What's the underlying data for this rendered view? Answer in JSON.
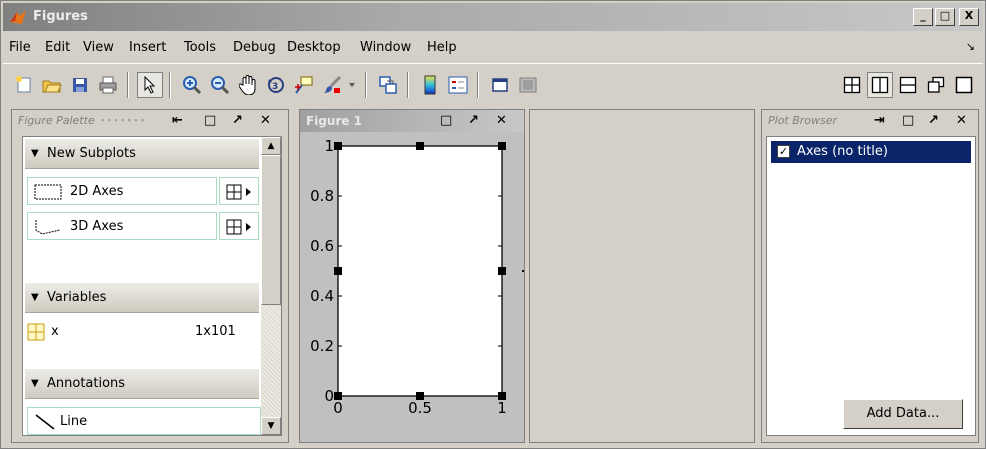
{
  "window": {
    "title": "Figures",
    "controls": {
      "minimize": "_",
      "maximize": "□",
      "close": "X"
    }
  },
  "menubar": {
    "items": [
      "File",
      "Edit",
      "View",
      "Insert",
      "Tools",
      "Debug",
      "Desktop",
      "Window",
      "Help"
    ],
    "dock_icon": "dock-arrow-icon"
  },
  "toolbar": {
    "tools": [
      "new-figure-icon",
      "open-file-icon",
      "save-icon",
      "print-icon",
      "pointer-icon",
      "zoom-in-icon",
      "zoom-out-icon",
      "pan-hand-icon",
      "rotate-3d-icon",
      "data-cursor-icon",
      "brush-icon",
      "link-plot-icon",
      "colorbar-icon",
      "legend-icon",
      "hide-plot-tools-icon",
      "show-plot-tools-icon"
    ],
    "layouts": [
      "tile-2x2-icon",
      "tile-columns-icon",
      "tile-rows-icon",
      "float-icon",
      "maximize-icon"
    ]
  },
  "palette": {
    "title": "Figure Palette",
    "sections": {
      "subplots": "New Subplots",
      "variables": "Variables",
      "annotations": "Annotations"
    },
    "subplot_items": [
      {
        "label": "2D Axes"
      },
      {
        "label": "3D Axes"
      }
    ],
    "variable": {
      "name": "x",
      "size": "1x101"
    },
    "annotation_item": "Line"
  },
  "figure": {
    "title": "Figure 1"
  },
  "chart_data": {
    "type": "line",
    "series": [],
    "xlim": [
      0,
      1
    ],
    "ylim": [
      0,
      1
    ],
    "xticks": [
      "0",
      "0.5",
      "1"
    ],
    "yticks": [
      "0",
      "0.2",
      "0.4",
      "0.6",
      "0.8",
      "1"
    ],
    "grid": false
  },
  "browser": {
    "title": "Plot Browser",
    "items": [
      {
        "label": "Axes (no title)",
        "checked": true,
        "check_mark": "✓"
      }
    ],
    "add_data_label": "Add Data..."
  }
}
